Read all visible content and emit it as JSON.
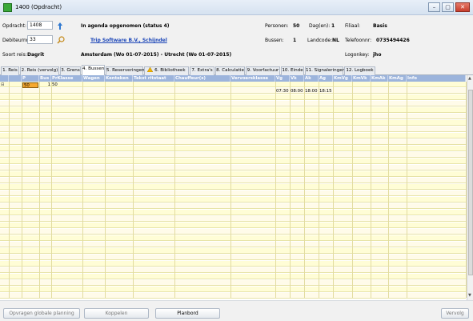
{
  "window": {
    "title": "1400 (Opdracht)",
    "controls": [
      "–",
      "▢",
      "✕"
    ]
  },
  "header": {
    "opdracht_label": "Opdracht:",
    "opdracht_value": "1408",
    "status": "In agenda opgenomen (status 4)",
    "debiteur_label": "Debiteurnr:",
    "debiteur_value": "33",
    "debiteur_name": "Trip Software B.V., Schijndel",
    "soort_label": "Soort reis:",
    "soort_value": "Dagrit",
    "route": "Amsterdam (Wo 01-07-2015) - Utrecht (Wo 01-07-2015)",
    "personen_label": "Personen:",
    "personen_value": "50",
    "dagen_label": "Dag(en):",
    "dagen_value": "1",
    "filiaal_label": "Filiaal:",
    "filiaal_value": "Basis",
    "bussen_label": "Bussen:",
    "bussen_value": "1",
    "landcode_label": "Landcode:",
    "landcode_value": "NL",
    "telefoon_label": "Telefoonnr:",
    "telefoon_value": "0735494426",
    "logon_label": "Logonkey:",
    "logon_value": "jho"
  },
  "tabs": [
    "1. Reis",
    "2. Reis (vervolg)",
    "3. Grens",
    "4. Bussen",
    "5. Reserveringen",
    "6. Bibliotheek",
    "7. Extra's",
    "8. Calculatie",
    "9. Voorfactuur",
    "10. Einde",
    "11. Signaleringen",
    "12. Logboek"
  ],
  "grid": {
    "columns": [
      "P",
      "Bus",
      "PrKlasse",
      "Wagen",
      "Kenteken",
      "Tekst ritstaat",
      "Chauffeur(s)",
      "Vervoersklasse",
      "Vg",
      "Vk",
      "Ak",
      "Ag",
      "KmVg",
      "KmVk",
      "KmAk",
      "KmAg",
      "Info"
    ],
    "rows": [
      {
        "expander": "⊟",
        "p": "50",
        "bus": "1",
        "prklasse": "50"
      },
      {
        "vg": "07:30",
        "vk": "08:00",
        "ak": "18:00",
        "ag": "18:15"
      }
    ]
  },
  "buttons": {
    "opvragen": "Opvragen globale planning",
    "koppelen": "Koppelen",
    "planbord": "Planbord",
    "vervolg": "Vervolg"
  }
}
